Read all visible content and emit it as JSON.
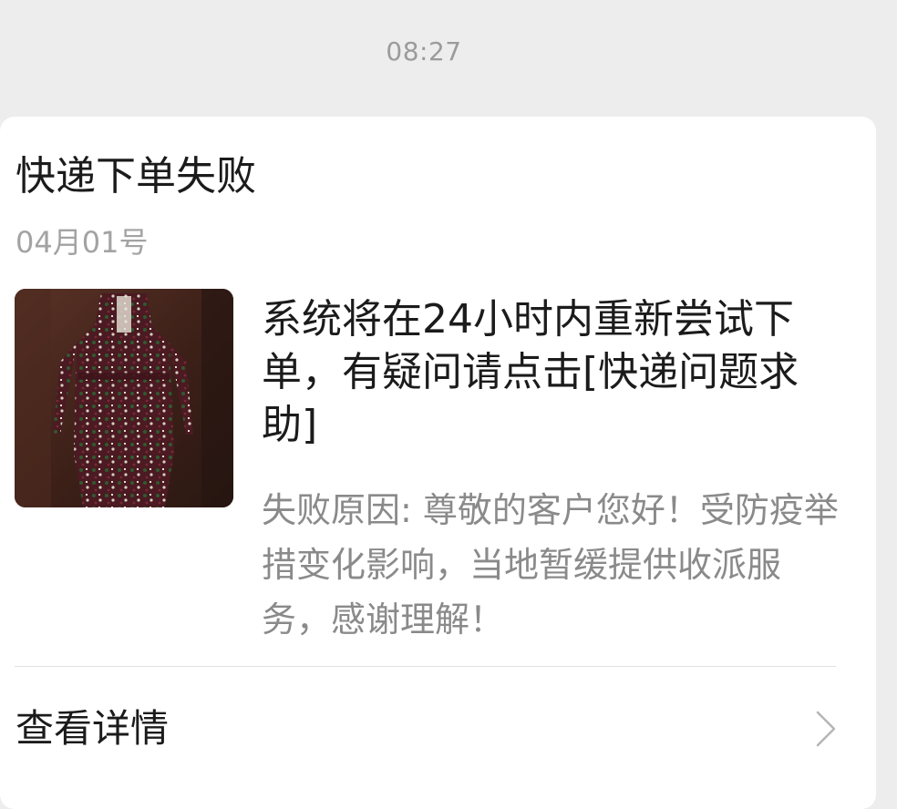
{
  "timestamp": "08:27",
  "card": {
    "title": "快递下单失败",
    "date": "04月01号",
    "headline": "系统将在24小时内重新尝试下单，有疑问请点击[快递问题求助]",
    "reason": "失败原因: 尊敬的客户您好！受防疫举措变化影响，当地暂缓提供收派服务，感谢理解！",
    "detail_label": "查看详情",
    "thumbnail_icon": "dress-product-image",
    "detail_icon": "chevron-right-icon"
  },
  "colors": {
    "background": "#ededed",
    "card": "#ffffff",
    "primary_text": "#1b1b1b",
    "secondary_text": "#8a8a8a",
    "divider": "#e1e1e1"
  }
}
